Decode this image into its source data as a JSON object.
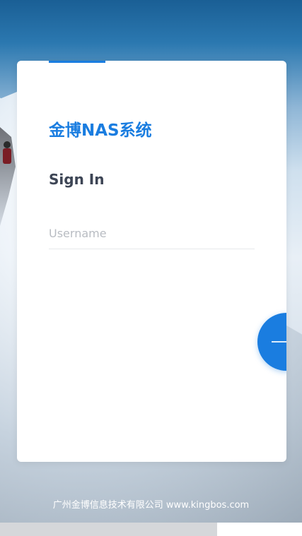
{
  "login": {
    "brand_title": "金博NAS系统",
    "heading": "Sign In",
    "username_placeholder": "Username",
    "username_value": "",
    "next_icon": "arrow-right-icon"
  },
  "footer": {
    "company_text": "广州金博信息技术有限公司 www.kingbos.com"
  },
  "colors": {
    "accent": "#1a7de0",
    "heading": "#3d4555",
    "placeholder": "#b8bcc2"
  }
}
